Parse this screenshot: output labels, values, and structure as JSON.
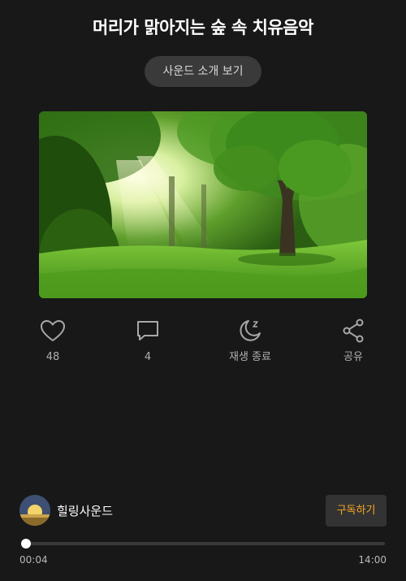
{
  "header": {
    "title": "머리가 맑아지는 숲 속 치유음악",
    "intro_button_label": "사운드 소개 보기"
  },
  "actions": {
    "like_count": "48",
    "comment_count": "4",
    "sleep_timer_label": "재생 종료",
    "share_label": "공유"
  },
  "channel": {
    "name": "힐링사운드",
    "subscribe_label": "구독하기"
  },
  "player": {
    "current_time": "00:04",
    "total_time": "14:00",
    "progress": 0.005
  },
  "colors": {
    "background": "#181818",
    "accent": "#f5a623",
    "button_bg": "#3a3a3a"
  },
  "icons": {
    "like": "heart-icon",
    "comment": "comment-icon",
    "sleep": "moon-icon",
    "share": "share-icon"
  }
}
